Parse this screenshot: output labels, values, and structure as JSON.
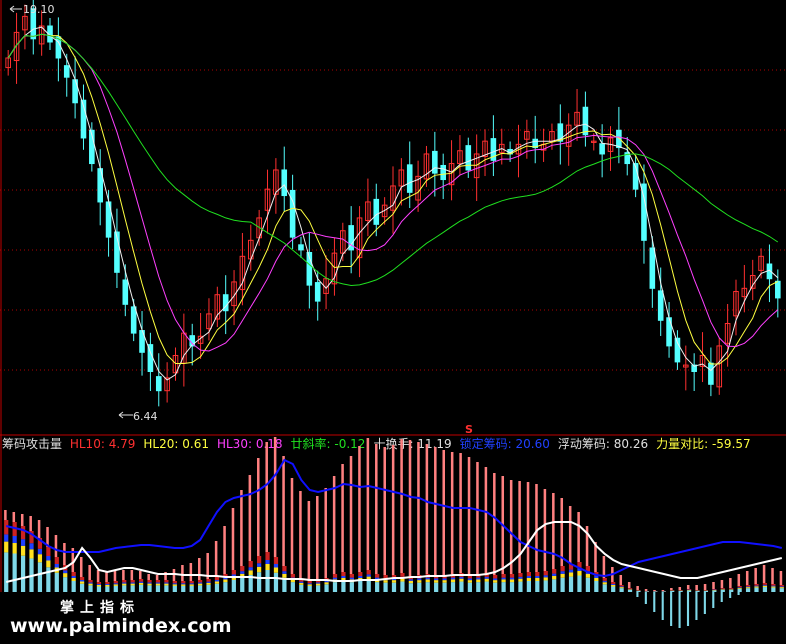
{
  "colors": {
    "background": "#000000",
    "up": "#ff3030",
    "down": "#54ffff",
    "ma_white": "#f0f0f0",
    "ma_yellow": "#ffff40",
    "ma_magenta": "#ff40ff",
    "ma_green": "#20e020",
    "grid": "#b00000",
    "blue_line": "#1010ff",
    "white_line": "#ffffff",
    "bars_red": "#cc2222",
    "bars_red_light": "#ff8080",
    "bars_cyan": "#7fd8e8",
    "bars_yellow": "#ffe020",
    "bars_blue": "#2040ff"
  },
  "price_labels": {
    "high": "19.10",
    "low": "6.44",
    "marker": "S"
  },
  "indicator": {
    "name": "筹码攻击量",
    "items": [
      {
        "label": "HL10: ",
        "value": "4.79",
        "color": "#ff3030"
      },
      {
        "label": "HL20: ",
        "value": "0.61",
        "color": "#ffff40"
      },
      {
        "label": "HL30: ",
        "value": "0.18",
        "color": "#ff40ff"
      },
      {
        "label": "廿斜率: ",
        "value": "-0.12",
        "color": "#20e020"
      },
      {
        "label": "十换手: ",
        "value": "11.19",
        "color": "#e0e0e0"
      },
      {
        "label": "锁定筹码: ",
        "value": "20.60",
        "color": "#2040ff"
      },
      {
        "label": "浮动筹码: ",
        "value": "80.26",
        "color": "#e0e0e0"
      },
      {
        "label": "力量对比: ",
        "value": "-59.57",
        "color": "#ffff40"
      }
    ]
  },
  "footer": {
    "cn": "掌上指标",
    "url": "www.palmindex.com"
  },
  "chart_data": [
    {
      "type": "candlestick",
      "title": "",
      "y_high_label": 19.1,
      "y_low_label": 6.44,
      "close": [
        17.6,
        18.4,
        18.9,
        18.2,
        18.6,
        18.1,
        17.6,
        17.0,
        16.2,
        15.1,
        14.3,
        13.1,
        12.0,
        10.9,
        9.9,
        9.0,
        8.4,
        7.8,
        7.2,
        7.6,
        8.3,
        9.0,
        8.6,
        8.9,
        9.6,
        10.2,
        9.7,
        10.6,
        11.4,
        11.9,
        12.6,
        13.5,
        14.1,
        13.3,
        12.0,
        11.6,
        10.5,
        10.0,
        10.7,
        11.5,
        12.2,
        11.6,
        12.6,
        13.1,
        12.4,
        13.0,
        13.6,
        14.1,
        13.4,
        13.9,
        14.6,
        14.0,
        13.8,
        14.3,
        14.7,
        14.1,
        14.6,
        15.0,
        14.4,
        14.9,
        14.6,
        14.9,
        15.3,
        14.8,
        14.9,
        15.3,
        15.0,
        15.5,
        15.9,
        15.2,
        15.0,
        14.6,
        15.1,
        14.8,
        14.3,
        13.5,
        11.9,
        10.4,
        9.4,
        8.6,
        8.1,
        8.0,
        7.8,
        8.3,
        7.4,
        8.6,
        9.3,
        10.3,
        10.4,
        10.8,
        11.4,
        10.7,
        10.1
      ],
      "mas": [
        {
          "name": "MA5",
          "color": "#f0f0f0"
        },
        {
          "name": "MA10",
          "color": "#ffff40"
        },
        {
          "name": "MA20",
          "color": "#ff40ff"
        },
        {
          "name": "MA60",
          "color": "#20e020"
        }
      ]
    },
    {
      "type": "bar",
      "title": "",
      "lower_stack": [
        72,
        70,
        66,
        61,
        54,
        45,
        35,
        27,
        20,
        15,
        12,
        10,
        10,
        11,
        12,
        12,
        13,
        12,
        12,
        12,
        11,
        11,
        11,
        12,
        13,
        15,
        18,
        22,
        26,
        31,
        36,
        40,
        35,
        26,
        18,
        13,
        11,
        12,
        14,
        18,
        20,
        18,
        20,
        22,
        18,
        17,
        17,
        19,
        16,
        17,
        18,
        17,
        17,
        18,
        19,
        17,
        18,
        19,
        17,
        18,
        18,
        19,
        20,
        20,
        21,
        23,
        26,
        28,
        30,
        26,
        20,
        14,
        10,
        7,
        4,
        2,
        1,
        1,
        1,
        2,
        2,
        3,
        2,
        2,
        3,
        4,
        4,
        6,
        7,
        8,
        9,
        8,
        7
      ],
      "red_extra": [
        10,
        10,
        12,
        15,
        18,
        20,
        22,
        22,
        24,
        20,
        15,
        12,
        11,
        10,
        10,
        10,
        8,
        6,
        5,
        8,
        12,
        16,
        18,
        22,
        26,
        36,
        48,
        62,
        76,
        86,
        98,
        110,
        120,
        110,
        96,
        88,
        80,
        84,
        90,
        98,
        108,
        118,
        126,
        132,
        130,
        128,
        130,
        134,
        136,
        133,
        130,
        128,
        125,
        122,
        120,
        118,
        112,
        106,
        102,
        98,
        94,
        92,
        90,
        88,
        82,
        76,
        68,
        58,
        50,
        40,
        30,
        22,
        15,
        10,
        6,
        4,
        2,
        1,
        1,
        2,
        3,
        4,
        5,
        6,
        7,
        8,
        10,
        12,
        14,
        16,
        18,
        16,
        14
      ],
      "negative": [
        0,
        0,
        0,
        0,
        0,
        0,
        0,
        0,
        0,
        0,
        0,
        0,
        0,
        0,
        0,
        0,
        0,
        0,
        0,
        0,
        0,
        0,
        0,
        0,
        0,
        0,
        0,
        0,
        0,
        0,
        0,
        0,
        0,
        0,
        0,
        0,
        0,
        0,
        0,
        0,
        0,
        0,
        0,
        0,
        0,
        0,
        0,
        0,
        0,
        0,
        0,
        0,
        0,
        0,
        0,
        0,
        0,
        0,
        0,
        0,
        0,
        0,
        0,
        0,
        0,
        0,
        0,
        0,
        0,
        0,
        0,
        0,
        0,
        0,
        0,
        5,
        12,
        20,
        28,
        34,
        36,
        34,
        28,
        22,
        16,
        10,
        6,
        3,
        0,
        0,
        0,
        0,
        0
      ],
      "blue_line": [
        66,
        64,
        62,
        58,
        52,
        46,
        42,
        40,
        40,
        40,
        40,
        40,
        42,
        44,
        45,
        46,
        47,
        47,
        46,
        45,
        44,
        44,
        46,
        52,
        66,
        80,
        90,
        94,
        96,
        98,
        102,
        108,
        118,
        132,
        128,
        112,
        102,
        100,
        102,
        104,
        108,
        107,
        105,
        106,
        104,
        102,
        100,
        98,
        95,
        94,
        90,
        88,
        86,
        84,
        84,
        84,
        82,
        80,
        74,
        66,
        58,
        50,
        46,
        42,
        40,
        38,
        34,
        28,
        24,
        20,
        17,
        16,
        18,
        22,
        26,
        30,
        32,
        34,
        36,
        38,
        40,
        42,
        44,
        46,
        48,
        50,
        50,
        50,
        49,
        48,
        47,
        46,
        44
      ],
      "white_line": [
        10,
        12,
        14,
        16,
        18,
        20,
        22,
        24,
        30,
        44,
        34,
        22,
        20,
        22,
        24,
        24,
        22,
        20,
        18,
        18,
        18,
        17,
        17,
        17,
        16,
        16,
        15,
        15,
        15,
        15,
        14,
        14,
        14,
        13,
        13,
        13,
        12,
        12,
        12,
        11,
        11,
        11,
        12,
        12,
        12,
        13,
        14,
        14,
        15,
        15,
        16,
        16,
        16,
        17,
        17,
        17,
        17,
        18,
        20,
        24,
        30,
        38,
        50,
        62,
        68,
        70,
        70,
        70,
        66,
        58,
        46,
        38,
        32,
        28,
        26,
        24,
        22,
        20,
        18,
        16,
        14,
        14,
        14,
        16,
        18,
        20,
        22,
        24,
        26,
        28,
        30,
        32,
        34
      ]
    }
  ]
}
